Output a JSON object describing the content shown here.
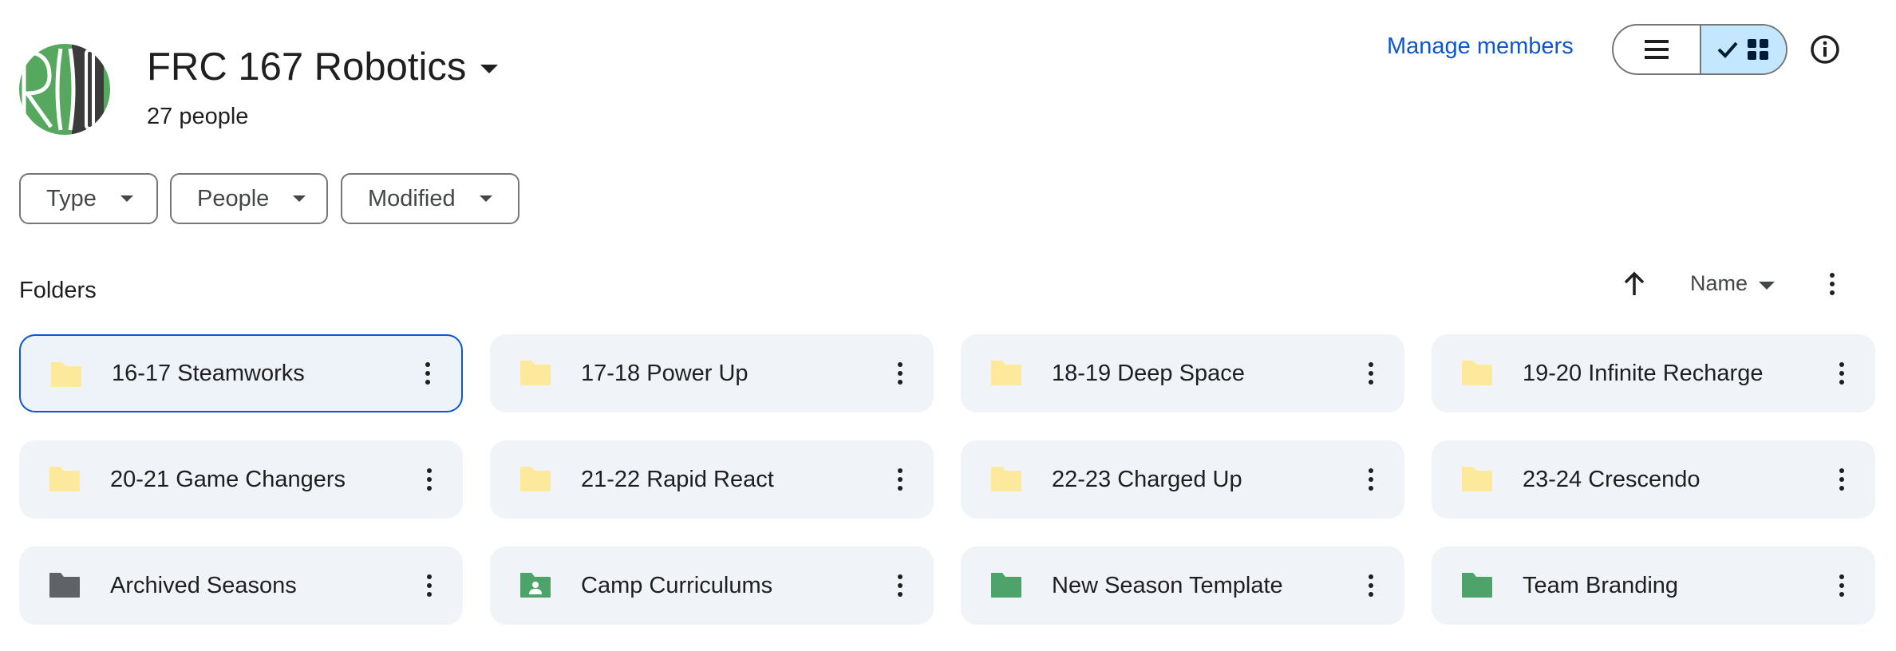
{
  "header": {
    "title": "FRC 167 Robotics",
    "member_count": "27 people",
    "manage_members": "Manage members"
  },
  "filters": [
    {
      "label": "Type"
    },
    {
      "label": "People"
    },
    {
      "label": "Modified"
    }
  ],
  "section": {
    "label": "Folders",
    "sort_label": "Name"
  },
  "colors": {
    "accent": "#0b57d0",
    "folder_yellow": "#fce8a1",
    "folder_gray": "#5f6368",
    "folder_green": "#4ea36a"
  },
  "folders": [
    {
      "name": "16-17 Steamworks",
      "icon": "folder-icon",
      "color": "#fde99c",
      "selected": true
    },
    {
      "name": "17-18 Power Up",
      "icon": "folder-icon",
      "color": "#fde99c"
    },
    {
      "name": "18-19 Deep Space",
      "icon": "folder-icon",
      "color": "#fde99c"
    },
    {
      "name": "19-20 Infinite Recharge",
      "icon": "folder-icon",
      "color": "#fde99c"
    },
    {
      "name": "20-21 Game Changers",
      "icon": "folder-icon",
      "color": "#fde99c"
    },
    {
      "name": "21-22 Rapid React",
      "icon": "folder-icon",
      "color": "#fde99c"
    },
    {
      "name": "22-23 Charged Up",
      "icon": "folder-icon",
      "color": "#fde99c"
    },
    {
      "name": "23-24 Crescendo",
      "icon": "folder-icon",
      "color": "#fde99c"
    },
    {
      "name": "Archived Seasons",
      "icon": "folder-icon",
      "color": "#5f6368"
    },
    {
      "name": "Camp Curriculums",
      "icon": "shared-folder-icon",
      "color": "#4ea36a"
    },
    {
      "name": "New Season Template",
      "icon": "folder-icon",
      "color": "#4ea36a"
    },
    {
      "name": "Team Branding",
      "icon": "folder-icon",
      "color": "#4ea36a"
    }
  ]
}
